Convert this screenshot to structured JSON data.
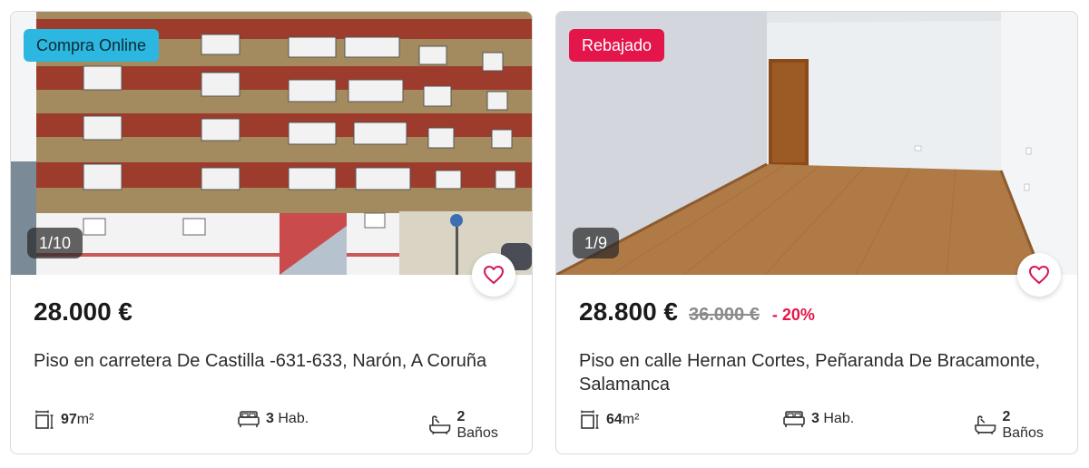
{
  "listings": [
    {
      "badge": "Compra Online",
      "badge_color": "#2cb7e0",
      "photo_counter": "1/10",
      "price": "28.000 €",
      "title": "Piso en carretera De Castilla -631-633, Narón, A Coruña",
      "area_value": "97",
      "area_unit": "m²",
      "rooms_value": "3",
      "rooms_unit": "Hab.",
      "baths_value": "2",
      "baths_unit": "Baños",
      "favorite_icon": "heart-icon"
    },
    {
      "badge": "Rebajado",
      "badge_color": "#e3154a",
      "photo_counter": "1/9",
      "price": "28.800 €",
      "old_price": "36.000 €",
      "discount": "- 20%",
      "title": "Piso en calle Hernan Cortes, Peñaranda De Bracamonte, Salamanca",
      "area_value": "64",
      "area_unit": "m²",
      "rooms_value": "3",
      "rooms_unit": "Hab.",
      "baths_value": "2",
      "baths_unit": "Baños",
      "favorite_icon": "heart-icon"
    }
  ]
}
